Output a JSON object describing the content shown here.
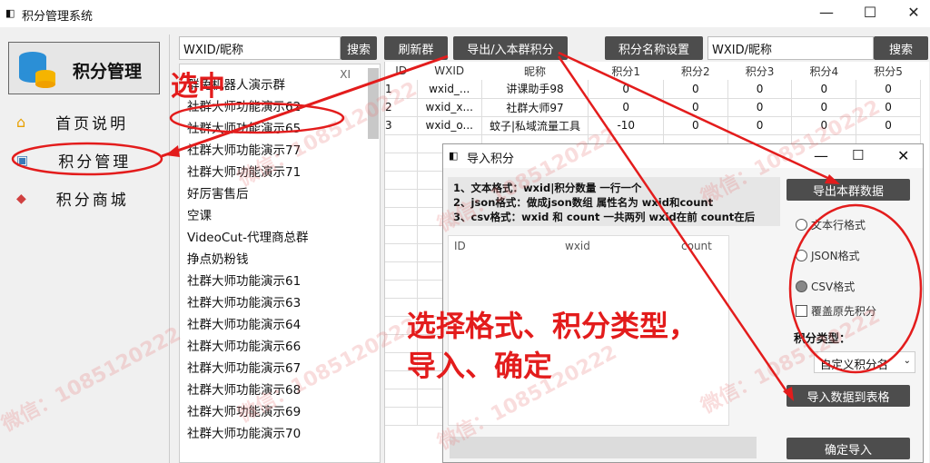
{
  "window": {
    "title": "积分管理系统",
    "min": "—",
    "max": "☐",
    "close": "✕"
  },
  "logo_text": "积分管理",
  "sidebar": [
    {
      "label": "首页说明",
      "icon": "home-icon"
    },
    {
      "label": "积分管理",
      "icon": "chat-icon"
    },
    {
      "label": "积分商城",
      "icon": "box-icon"
    }
  ],
  "search_left": {
    "value": "WXID/昵称",
    "button": "搜索"
  },
  "toolbar": {
    "refresh": "刷新群",
    "export_import": "导出/入本群积分",
    "name_settings": "积分名称设置",
    "search_value": "WXID/昵称",
    "search_button": "搜索"
  },
  "group_header_fragment": "XI",
  "groups": [
    "群免机器人演示群",
    "社群大师功能演示62",
    "社群大师功能演示65",
    "社群大师功能演示77",
    "社群大师功能演示71",
    "好厉害售后",
    "空课",
    "VideoCut-代理商总群",
    "挣点奶粉钱",
    "社群大师功能演示61",
    "社群大师功能演示63",
    "社群大师功能演示64",
    "社群大师功能演示66",
    "社群大师功能演示67",
    "社群大师功能演示68",
    "社群大师功能演示69",
    "社群大师功能演示70"
  ],
  "table": {
    "headers": [
      "ID",
      "WXID",
      "昵称",
      "积分1",
      "积分2",
      "积分3",
      "积分4",
      "积分5"
    ],
    "rows": [
      [
        "1",
        "wxid_...",
        "讲课助手98",
        "0",
        "0",
        "0",
        "0",
        "0"
      ],
      [
        "2",
        "wxid_x...",
        "社群大师97",
        "0",
        "0",
        "0",
        "0",
        "0"
      ],
      [
        "3",
        "wxid_o...",
        "蚊子|私域流量工具",
        "-10",
        "0",
        "0",
        "0",
        "0"
      ]
    ]
  },
  "dialog": {
    "title": "导入积分",
    "lines": [
      "1、文本格式：wxid|积分数量 一行一个",
      "2、json格式：做成json数组 属性名为 wxid和count",
      "3、csv格式：wxid 和 count 一共两列 wxid在前 count在后"
    ],
    "cols": [
      "ID",
      "wxid",
      "count"
    ],
    "export_btn": "导出本群数据",
    "formats": [
      "文本行格式",
      "JSON格式",
      "CSV格式"
    ],
    "overwrite": "覆盖原先积分",
    "type_label": "积分类型：",
    "type_value": "自定义积分名",
    "import_btn": "导入数据到表格",
    "confirm_btn": "确定导入"
  },
  "annotations": {
    "select": "选中",
    "instruction_line1": "选择格式、积分类型，",
    "instruction_line2": "导入、确定"
  },
  "watermark": "微信：1085120222"
}
